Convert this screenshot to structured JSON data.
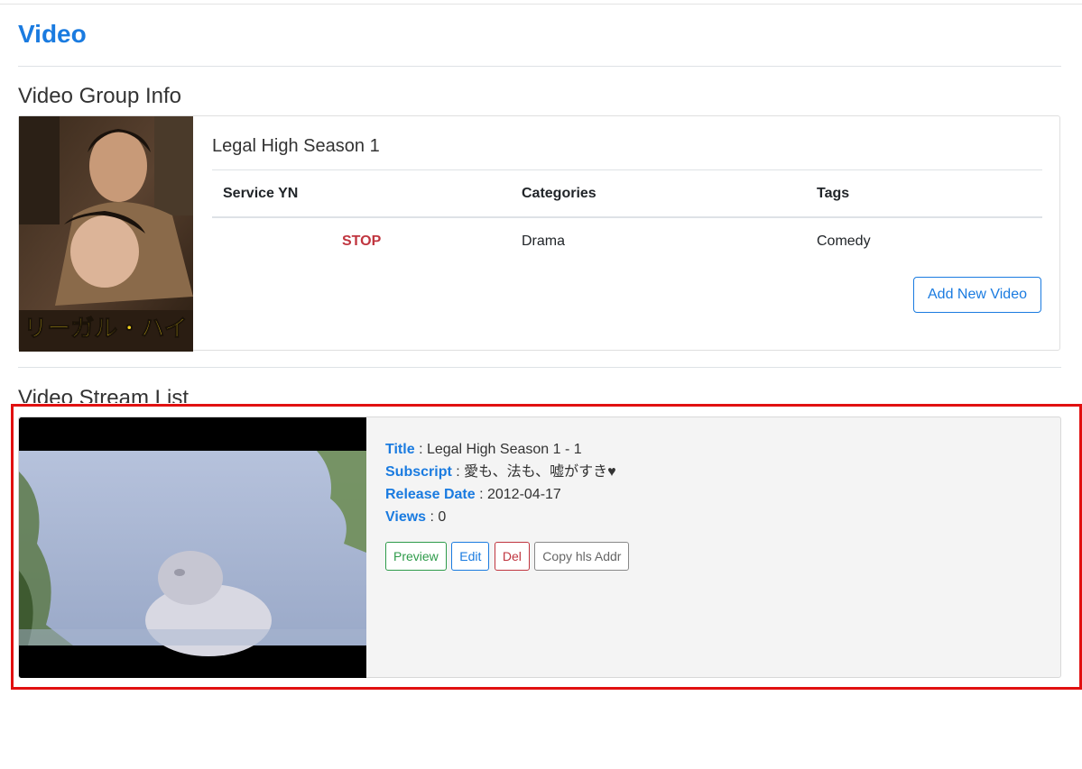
{
  "page": {
    "title": "Video"
  },
  "group_section": {
    "heading": "Video Group Info",
    "poster": {
      "caption": "リーガル・ハイ"
    },
    "name": "Legal High Season 1",
    "table": {
      "headers": [
        "Service YN",
        "Categories",
        "Tags"
      ],
      "row": {
        "service_yn": "STOP",
        "categories": "Drama",
        "tags": "Comedy"
      }
    },
    "add_button": "Add New Video"
  },
  "stream_section": {
    "heading": "Video Stream List",
    "streams": [
      {
        "title_label": "Title",
        "title": "Legal High Season 1 - 1",
        "subscript_label": "Subscript",
        "subscript": "愛も、法も、嘘がすき♥",
        "release_label": "Release Date",
        "release_date": "2012-04-17",
        "views_label": "Views",
        "views": "0",
        "buttons": {
          "preview": "Preview",
          "edit": "Edit",
          "del": "Del",
          "copy": "Copy hls Addr"
        }
      }
    ]
  },
  "colors": {
    "accent": "#1a7be0",
    "stop": "#c0353f",
    "highlight": "#e11010",
    "preview": "#2e9b4a"
  }
}
